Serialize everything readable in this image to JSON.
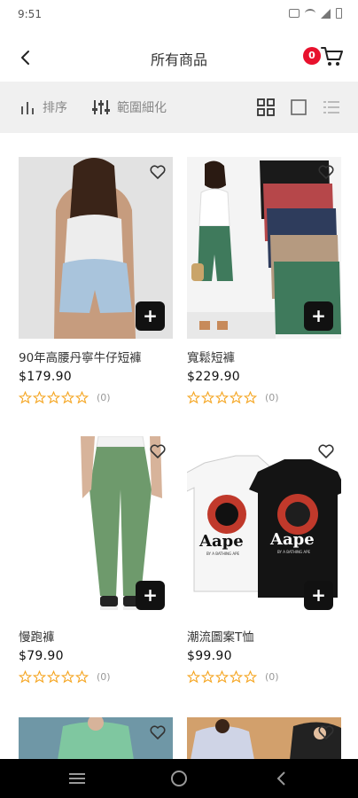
{
  "status_bar": {
    "time": "9:51"
  },
  "header": {
    "title": "所有商品",
    "cart_count": "0"
  },
  "filter_bar": {
    "sort_label": "排序",
    "range_label": "範圍細化"
  },
  "colors": {
    "accent": "#e8112d",
    "star": "#f5a623",
    "button_dark": "#111111",
    "filter_bg": "#f0f0f0"
  },
  "icons": [
    "back-arrow-icon",
    "cart-icon",
    "sort-icon",
    "filter-sliders-icon",
    "grid-view-icon",
    "single-view-icon",
    "list-view-icon",
    "heart-icon",
    "plus-icon",
    "star-outline-icon",
    "menu-icon",
    "home-circle-icon",
    "back-triangle-icon"
  ],
  "products": [
    {
      "name": "90年高腰丹寧牛仔短褲",
      "price": "$179.90",
      "rating_count": "(0)"
    },
    {
      "name": "寬鬆短褲",
      "price": "$229.90",
      "rating_count": "(0)"
    },
    {
      "name": "慢跑褲",
      "price": "$79.90",
      "rating_count": "(0)"
    },
    {
      "name": "潮流圖案T恤",
      "price": "$99.90",
      "rating_count": "(0)"
    }
  ],
  "tshirt_print": {
    "brand": "Aape",
    "subtext": "BY A BATHING APE"
  },
  "add_label": "+"
}
